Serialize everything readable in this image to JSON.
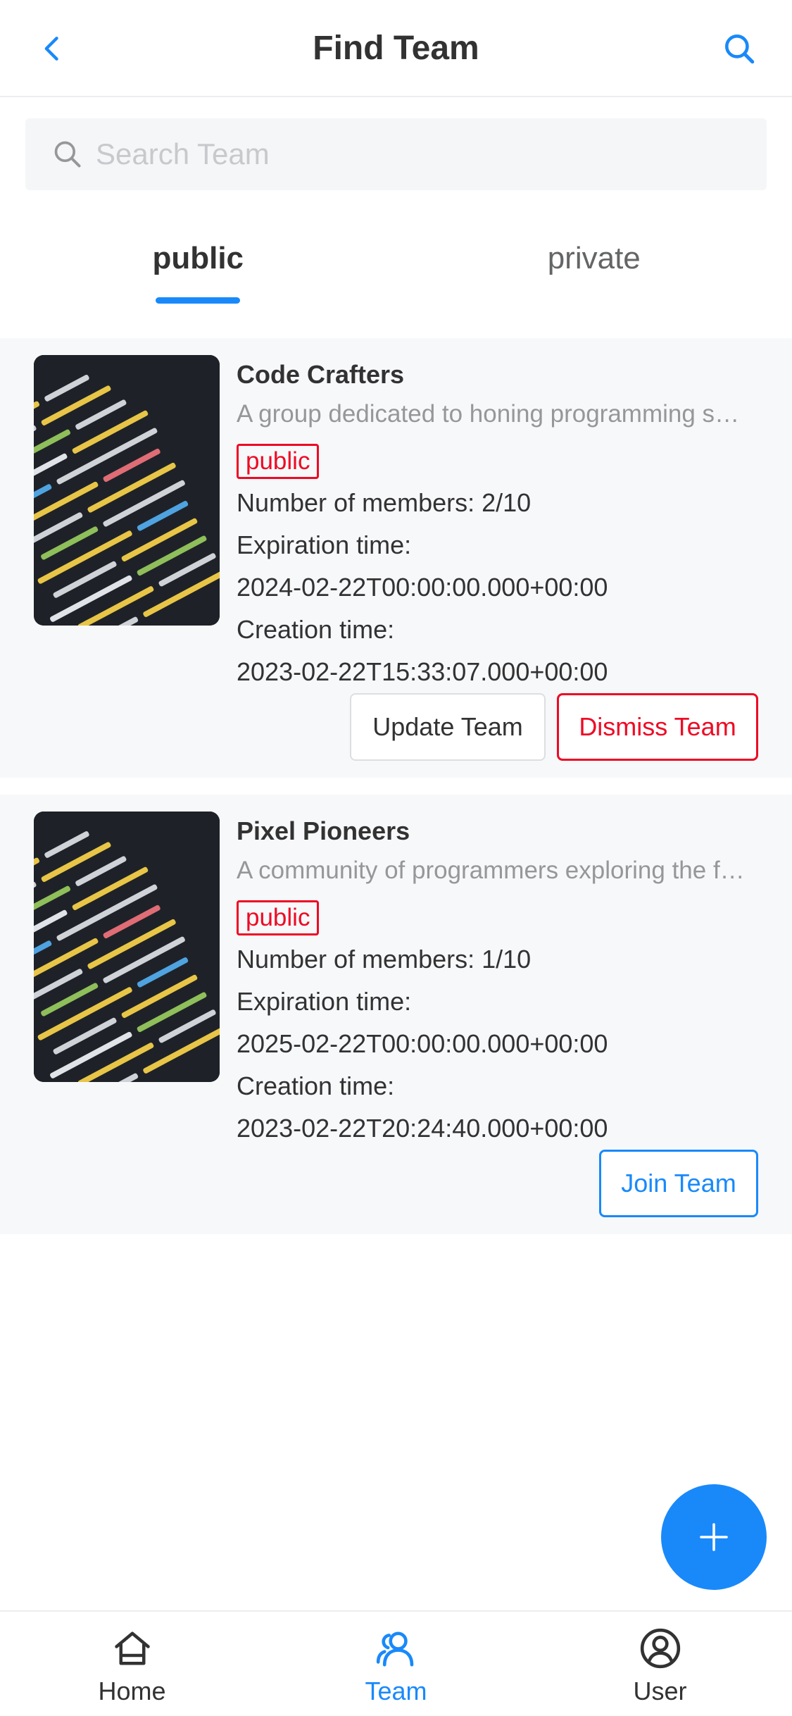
{
  "header": {
    "title": "Find Team",
    "back_icon": "chevron-left-icon",
    "search_icon": "search-icon"
  },
  "search": {
    "placeholder": "Search Team",
    "value": ""
  },
  "tabs": [
    {
      "label": "public",
      "active": true
    },
    {
      "label": "private",
      "active": false
    }
  ],
  "teams": [
    {
      "name": "Code Crafters",
      "description": "A group dedicated to honing programming skills",
      "tag": "public",
      "members": "Number of members: 2/10",
      "expiration_label": "Expiration time:",
      "expiration": "2024-02-22T00:00:00.000+00:00",
      "creation_label": "Creation time:",
      "creation": "2023-02-22T15:33:07.000+00:00",
      "actions": [
        "Update Team",
        "Dismiss Team"
      ]
    },
    {
      "name": "Pixel Pioneers",
      "description": "A community of programmers exploring the frontier",
      "tag": "public",
      "members": "Number of members: 1/10",
      "expiration_label": "Expiration time:",
      "expiration": "2025-02-22T00:00:00.000+00:00",
      "creation_label": "Creation time:",
      "creation": "2023-02-22T20:24:40.000+00:00",
      "actions": [
        "Join Team"
      ]
    }
  ],
  "fab": {
    "icon": "plus-icon"
  },
  "tabbar": [
    {
      "label": "Home",
      "icon": "home-icon",
      "active": false
    },
    {
      "label": "Team",
      "icon": "team-icon",
      "active": true
    },
    {
      "label": "User",
      "icon": "user-icon",
      "active": false
    }
  ],
  "colors": {
    "accent": "#1989fa",
    "danger": "#ee0a24",
    "card_bg": "#f7f8fa"
  }
}
